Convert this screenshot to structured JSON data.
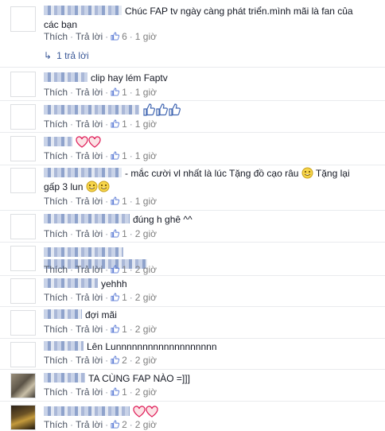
{
  "actions": {
    "like": "Thích",
    "reply": "Trả lời"
  },
  "replies_link": "1 trả lời",
  "comments": [
    {
      "text": "Chúc FAP tv ngày càng phát triển.mình mãi là fan của các bạn",
      "likes": "6",
      "time": "1 giờ"
    },
    {
      "text": "clip hay lém Faptv",
      "likes": "1",
      "time": "1 giờ"
    },
    {
      "text": "",
      "likes": "1",
      "time": "1 giờ"
    },
    {
      "text": "",
      "likes": "1",
      "time": "1 giờ"
    },
    {
      "text": "- mắc cười vl nhất là lúc Tặng đồ cạo râu",
      "text2": "Tặng lại gấp 3 lun",
      "likes": "1",
      "time": "1 giờ"
    },
    {
      "text": "đúng h ghê ^^",
      "likes": "1",
      "time": "2 giờ"
    },
    {
      "text": "",
      "likes": "1",
      "time": "2 giờ"
    },
    {
      "text": "yehhh",
      "likes": "1",
      "time": "2 giờ"
    },
    {
      "text": "đợi mãi",
      "likes": "1",
      "time": "2 giờ"
    },
    {
      "text": "Lên Lunnnnnnnnnnnnnnnnnnn",
      "likes": "2",
      "time": "2 giờ"
    },
    {
      "text": "TA CÙNG FAP NÀO =]]]",
      "likes": "1",
      "time": "2 giờ"
    },
    {
      "text": "",
      "likes": "2",
      "time": "2 giờ"
    }
  ]
}
